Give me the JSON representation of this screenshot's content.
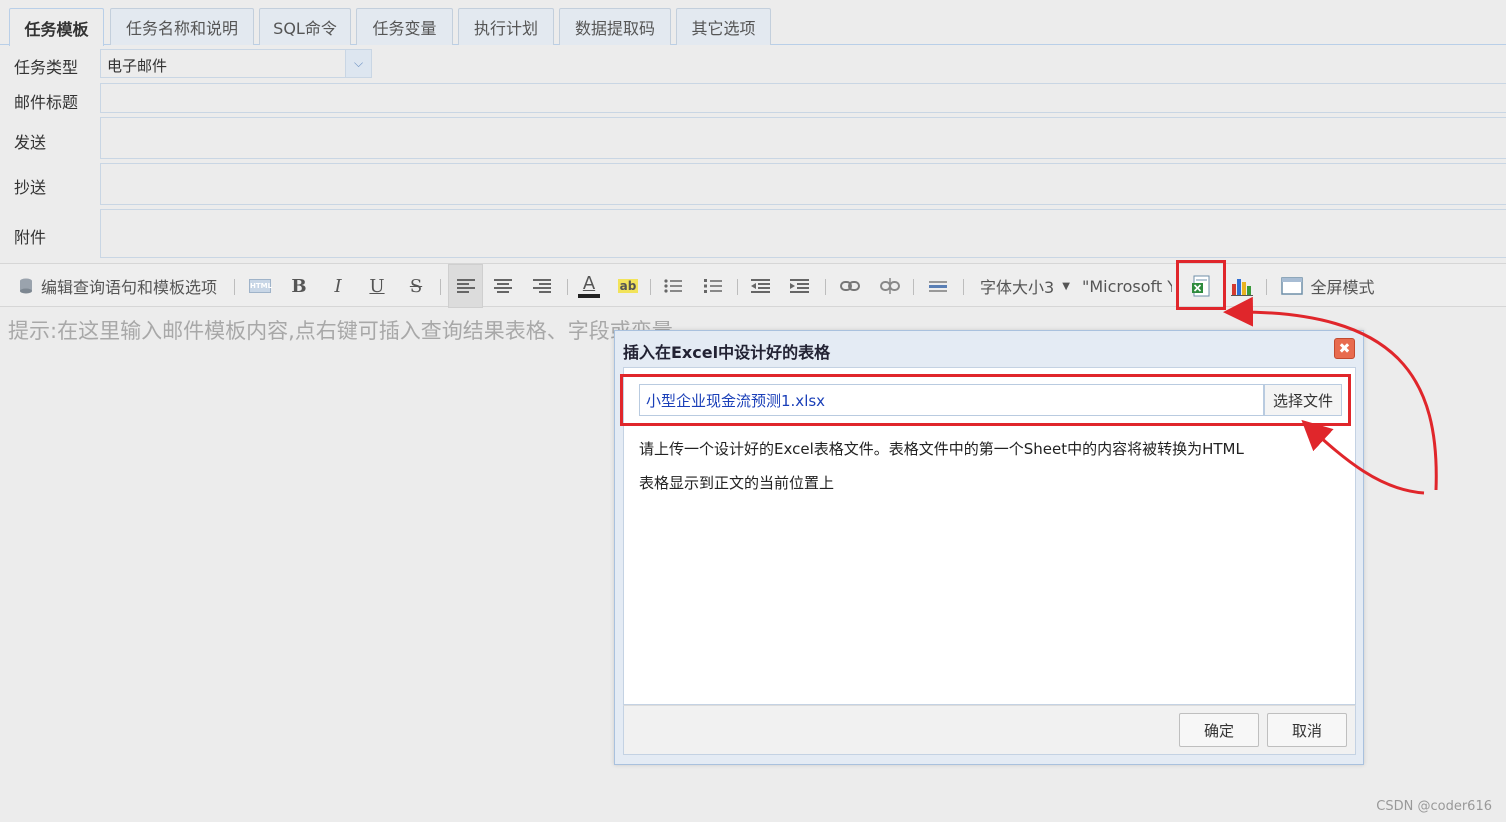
{
  "tabs": [
    {
      "label": "任务模板",
      "active": true
    },
    {
      "label": "任务名称和说明",
      "active": false
    },
    {
      "label": "SQL命令",
      "active": false
    },
    {
      "label": "任务变量",
      "active": false
    },
    {
      "label": "执行计划",
      "active": false
    },
    {
      "label": "数据提取码",
      "active": false
    },
    {
      "label": "其它选项",
      "active": false
    }
  ],
  "form": {
    "task_type_label": "任务类型",
    "task_type_value": "电子邮件",
    "subject_label": "邮件标题",
    "to_label": "发送",
    "cc_label": "抄送",
    "attachment_label": "附件"
  },
  "toolbar": {
    "edit_query_label": "编辑查询语句和模板选项",
    "html_label": "HTML",
    "bold": "B",
    "italic": "I",
    "underline": "U",
    "strike": "S",
    "font_color": "A",
    "highlight": "ab",
    "font_size": "字体大小3",
    "font_family": "\"Microsoft Ya",
    "fullscreen_label": "全屏模式"
  },
  "editor": {
    "hint": "提示:在这里输入邮件模板内容,点右键可插入查询结果表格、字段或变量"
  },
  "dialog": {
    "title": "插入在Excel中设计好的表格",
    "file_value": "小型企业现金流预测1.xlsx",
    "choose_file": "选择文件",
    "desc_line1": "请上传一个设计好的Excel表格文件。表格文件中的第一个Sheet中的内容将被转换为HTML",
    "desc_line2": "表格显示到正文的当前位置上",
    "ok": "确定",
    "cancel": "取消"
  },
  "watermark": "CSDN @coder616",
  "colors": {
    "accent": "#e0262b",
    "border": "#b9cfe8"
  }
}
